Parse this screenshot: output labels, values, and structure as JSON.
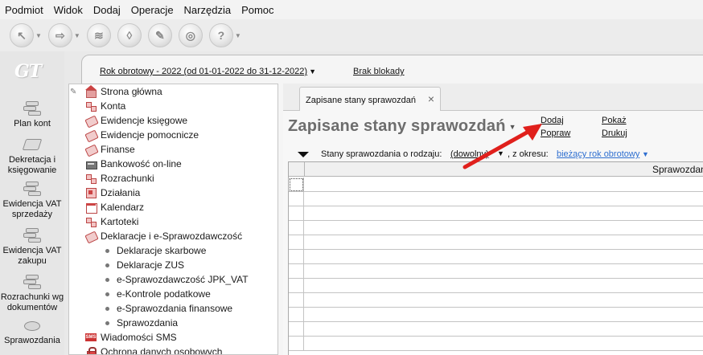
{
  "menubar": [
    "Podmiot",
    "Widok",
    "Dodaj",
    "Operacje",
    "Narzędzia",
    "Pomoc"
  ],
  "toolbar": {
    "buttons": [
      {
        "name": "cursor-icon",
        "glyph": "↖",
        "dropdown": true
      },
      {
        "name": "document-arrow-icon",
        "glyph": "⇨",
        "dropdown": true
      },
      {
        "name": "coins-icon",
        "glyph": "≋",
        "dropdown": false
      },
      {
        "name": "book-icon",
        "glyph": "◊",
        "dropdown": false
      },
      {
        "name": "tools-icon",
        "glyph": "✎",
        "dropdown": false
      },
      {
        "name": "disk-icon",
        "glyph": "◎",
        "dropdown": false
      },
      {
        "name": "help-icon",
        "glyph": "?",
        "dropdown": true
      }
    ]
  },
  "logo": "GT",
  "leftstrip": [
    {
      "label": "Plan kont",
      "icon": "coins-stack-icon"
    },
    {
      "label": "Dekretacja i księgowanie",
      "icon": "ledger-book-icon"
    },
    {
      "label": "Ewidencja VAT sprzedaży",
      "icon": "coins-stack-icon"
    },
    {
      "label": "Ewidencja VAT zakupu",
      "icon": "coins-stack-icon"
    },
    {
      "label": "Rozrachunki wg dokumentów",
      "icon": "documents-icon"
    },
    {
      "label": "Sprawozdania",
      "icon": "disk-icon"
    }
  ],
  "yearbar": {
    "year": "Rok obrotowy - 2022  (od 01-01-2022 do 31-12-2022)",
    "lock": "Brak blokady"
  },
  "tree": {
    "nodes": [
      {
        "label": "Strona główna",
        "icon": "home-icon",
        "cls": "home"
      },
      {
        "label": "Konta",
        "icon": "accounts-icon",
        "cls": "konta"
      },
      {
        "label": "Ewidencje księgowe",
        "icon": "ledger-icon",
        "cls": "book2"
      },
      {
        "label": "Ewidencje pomocnicze",
        "icon": "ledger-icon",
        "cls": "book2"
      },
      {
        "label": "Finanse",
        "icon": "ledger-icon",
        "cls": "book2"
      },
      {
        "label": "Bankowość on-line",
        "icon": "bank-icon",
        "cls": "bank"
      },
      {
        "label": "Rozrachunki",
        "icon": "accounts-icon",
        "cls": "konta"
      },
      {
        "label": "Działania",
        "icon": "actions-icon",
        "cls": "dzial"
      },
      {
        "label": "Kalendarz",
        "icon": "calendar-icon",
        "cls": "kal"
      },
      {
        "label": "Kartoteki",
        "icon": "accounts-icon",
        "cls": "konta"
      },
      {
        "label": "Deklaracje i e-Sprawozdawczość",
        "icon": "ledger-icon",
        "cls": "book2"
      }
    ],
    "subitems": [
      "Deklaracje skarbowe",
      "Deklaracje ZUS",
      "e-Sprawozdawczość JPK_VAT",
      "e-Kontrole podatkowe",
      "e-Sprawozdania finansowe",
      "Sprawozdania"
    ],
    "tail": [
      {
        "label": "Wiadomości SMS",
        "icon": "sms-icon",
        "cls": "sms"
      },
      {
        "label": "Ochrona danych osobowych",
        "icon": "lock-icon",
        "cls": "lock"
      }
    ]
  },
  "tab": {
    "label": "Zapisane stany sprawozdań"
  },
  "page": {
    "title": "Zapisane stany sprawozdań",
    "actions": {
      "dodaj": "Dodaj",
      "popraw": "Popraw",
      "pokaz": "Pokaż",
      "drukuj": "Drukuj"
    }
  },
  "filters": {
    "kind_label": "Stany sprawozdania o rodzaju:",
    "kind_value": "(dowolny)",
    "period_label": ", z okresu:",
    "period_value": "bieżący rok obrotowy"
  },
  "grid": {
    "column": "Sprawozdanie",
    "row_count": 12
  },
  "annotation": {
    "color": "#e0201c"
  }
}
